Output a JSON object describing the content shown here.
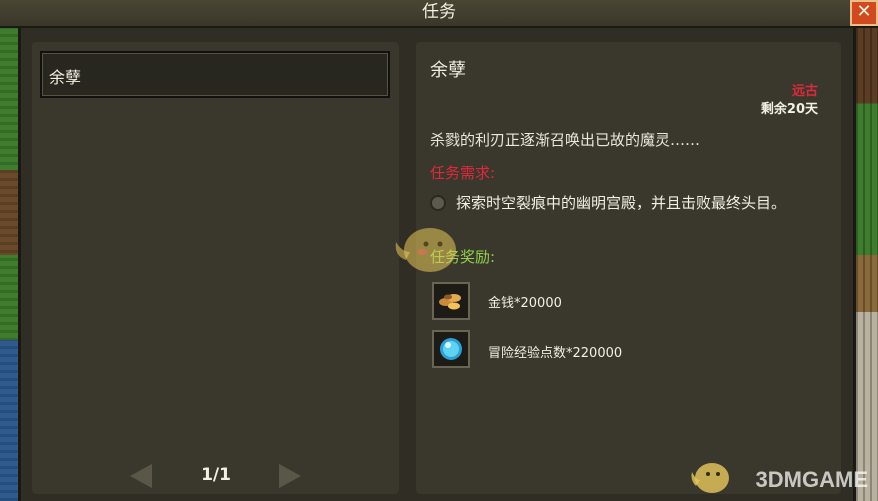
{
  "window": {
    "title": "任务",
    "close_label": "✕"
  },
  "quest_list": {
    "items": [
      {
        "label": "余孽"
      }
    ],
    "pager": {
      "text": "1/1"
    }
  },
  "quest_detail": {
    "title": "余孽",
    "era": "远古",
    "days_left": "剩余20天",
    "description": "杀戮的利刃正逐渐召唤出已故的魔灵……",
    "requirements_heading": "任务需求:",
    "requirements": [
      {
        "text": "探索时空裂痕中的幽明宫殿，并且击败最终头目。",
        "icon": "bullet-icon"
      }
    ],
    "rewards_heading": "任务奖励:",
    "rewards": [
      {
        "text": "金钱*20000",
        "icon": "gold-coins-icon"
      },
      {
        "text": "冒险经验点数*220000",
        "icon": "blue-gem-icon"
      }
    ]
  },
  "watermark": {
    "text": "3DMGAME"
  },
  "colors": {
    "accent_red": "#e0283c",
    "accent_green": "#8fd14a",
    "panel": "#3a382d",
    "close_button": "#d2481f"
  }
}
